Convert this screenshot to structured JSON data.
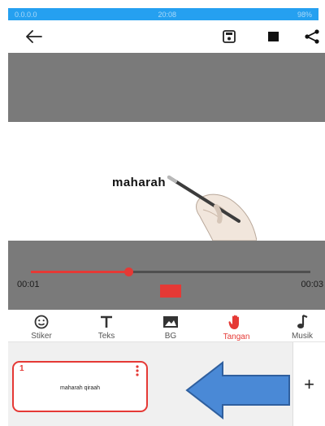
{
  "status_bar": {
    "left": "0.0.0.0",
    "center": "20:08",
    "right": "98%"
  },
  "toolbar": {
    "back_icon": "arrow-back-icon",
    "save_icon": "floppy-save-icon",
    "stop_icon": "stop-square-icon",
    "share_icon": "share-icon"
  },
  "canvas": {
    "text": "maharah"
  },
  "player": {
    "progress": 0.35,
    "current_time": "00:01",
    "total_time": "00:03",
    "accent_color": "#e53935"
  },
  "tabs": [
    {
      "label": "Stiker",
      "icon": "smiley-icon",
      "active": false
    },
    {
      "label": "Teks",
      "icon": "text-icon",
      "active": false
    },
    {
      "label": "BG",
      "icon": "image-icon",
      "active": false
    },
    {
      "label": "Tangan",
      "icon": "hand-icon",
      "active": true
    },
    {
      "label": "Musik",
      "icon": "music-note-icon",
      "active": false
    }
  ],
  "scenes": [
    {
      "number": "1",
      "title": "maharah qiraah",
      "selected": true
    }
  ],
  "add_scene": {
    "label": "+"
  }
}
